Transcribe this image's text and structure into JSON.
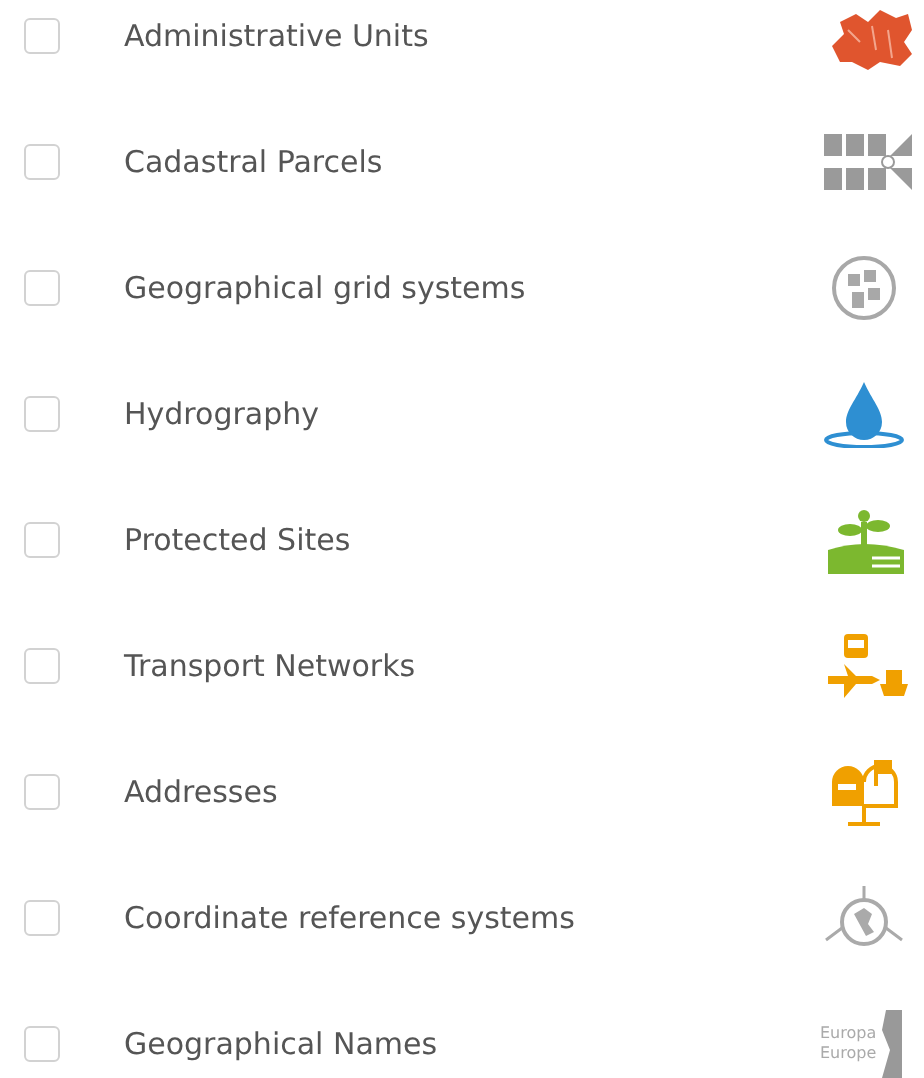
{
  "layers": [
    {
      "label": "Administrative Units",
      "checked": false,
      "icon": {
        "kind": "map"
      }
    },
    {
      "label": "Cadastral Parcels",
      "checked": false,
      "icon": {
        "kind": "parcels"
      }
    },
    {
      "label": "Geographical grid systems",
      "checked": false,
      "icon": {
        "kind": "grid-globe"
      }
    },
    {
      "label": "Hydrography",
      "checked": false,
      "icon": {
        "kind": "drop"
      }
    },
    {
      "label": "Protected Sites",
      "checked": false,
      "icon": {
        "kind": "plant"
      }
    },
    {
      "label": "Transport Networks",
      "checked": false,
      "icon": {
        "kind": "transport"
      }
    },
    {
      "label": "Addresses",
      "checked": false,
      "icon": {
        "kind": "mailbox"
      }
    },
    {
      "label": "Coordinate reference systems",
      "checked": false,
      "icon": {
        "kind": "axes-globe"
      }
    },
    {
      "label": "Geographical Names",
      "checked": false,
      "icon": {
        "kind": "names",
        "lines": [
          "Europa",
          "Europe"
        ]
      }
    }
  ]
}
